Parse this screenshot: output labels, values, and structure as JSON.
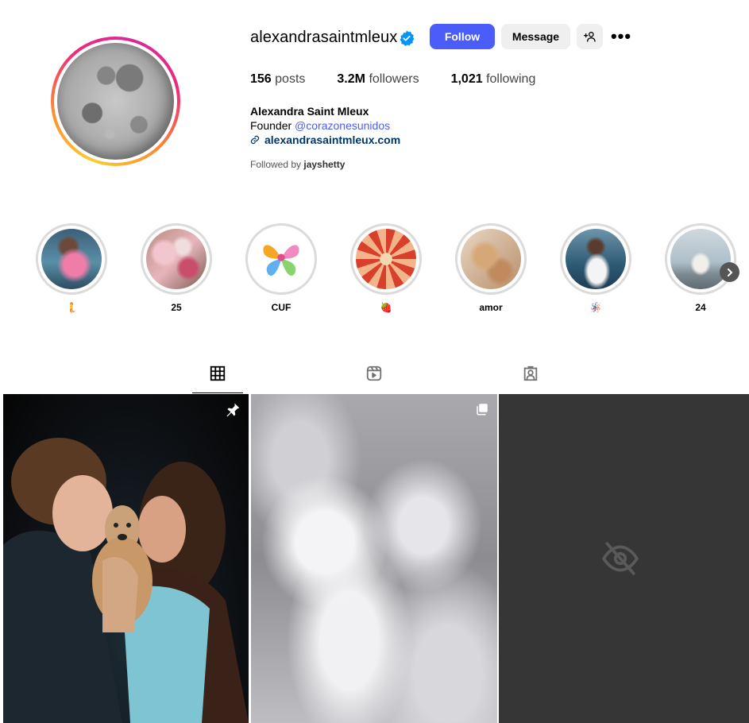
{
  "profile": {
    "username": "alexandrasaintmleux",
    "follow_label": "Follow",
    "message_label": "Message",
    "more_label": "•••",
    "stats": {
      "posts_count": "156",
      "posts_label": "posts",
      "followers_count": "3.2M",
      "followers_label": "followers",
      "following_count": "1,021",
      "following_label": "following"
    },
    "full_name": "Alexandra Saint Mleux",
    "bio_prefix": "Founder ",
    "bio_mention": "@corazonesunidos",
    "link": "alexandrasaintmleux.com",
    "followed_by_prefix": "Followed by ",
    "followed_by_user": "jayshetty"
  },
  "highlights": [
    {
      "label": "🧜"
    },
    {
      "label": "25"
    },
    {
      "label": "CUF"
    },
    {
      "label": "🍓"
    },
    {
      "label": "amor"
    },
    {
      "label": "🪅"
    },
    {
      "label": "24"
    }
  ],
  "colors": {
    "accent": "#4a5df9",
    "link": "#00376b"
  }
}
